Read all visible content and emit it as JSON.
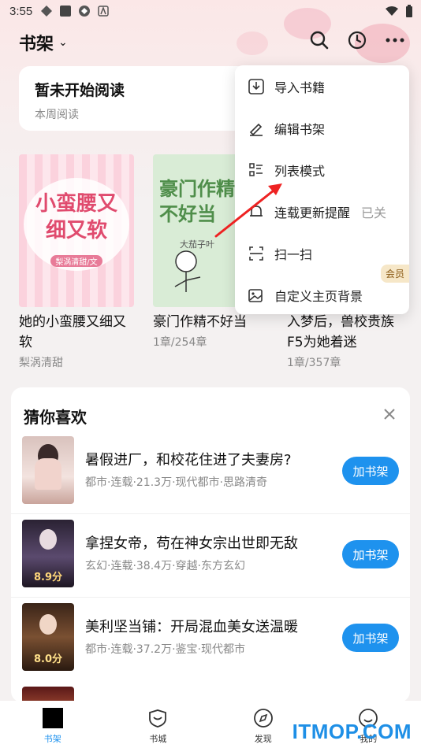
{
  "status_bar": {
    "time": "3:55"
  },
  "header": {
    "title": "书架",
    "caret": "⌄"
  },
  "reading": {
    "title": "暂未开始阅读",
    "subtitle": "本周阅读"
  },
  "shelf": [
    {
      "title_line1": "她的小蛮腰又细又",
      "title_line2": "软",
      "meta": "梨涡清甜",
      "cover_text": "小蛮腰又细又软",
      "cover_author": "梨涡清甜/文"
    },
    {
      "title_line1": "豪门作精不好当",
      "title_line2": "",
      "meta": "1章/254章",
      "cover_text": "豪门作精不好当",
      "cover_author": "大茄子叶"
    },
    {
      "title_line1": "入梦后，兽校贵族",
      "title_line2": "F5为她着迷",
      "meta": "1章/357章"
    }
  ],
  "menu": {
    "items": [
      {
        "label": "导入书籍",
        "icon": "import-icon"
      },
      {
        "label": "编辑书架",
        "icon": "edit-icon"
      },
      {
        "label": "列表模式",
        "icon": "list-icon"
      },
      {
        "label": "连载更新提醒",
        "icon": "bell-icon",
        "status": "已关"
      },
      {
        "label": "扫一扫",
        "icon": "scan-icon"
      },
      {
        "label": "自定义主页背景",
        "icon": "image-icon",
        "badge": "会员"
      }
    ]
  },
  "recommend": {
    "title": "猜你喜欢",
    "add_label": "加书架",
    "items": [
      {
        "name": "暑假进厂，和校花住进了夫妻房?",
        "meta": "都市·连载·21.3万·现代都市·思路清奇"
      },
      {
        "name": "拿捏女帝，苟在神女宗出世即无敌",
        "meta": "玄幻·连载·38.4万·穿越·东方玄幻",
        "cover_score": "8.9分"
      },
      {
        "name": "美利坚当铺：开局混血美女送温暖",
        "meta": "都市·连载·37.2万·鉴宝·现代都市",
        "cover_score": "8.0分"
      }
    ]
  },
  "nav": [
    {
      "label": "书架",
      "icon": "bookshelf-icon",
      "active": true
    },
    {
      "label": "书城",
      "icon": "bookstore-icon"
    },
    {
      "label": "发现",
      "icon": "compass-icon"
    },
    {
      "label": "我的",
      "icon": "profile-icon"
    }
  ],
  "watermark": "ITMOP.COM",
  "colors": {
    "accent": "#1e92ee",
    "cover1": "#f9c9d6",
    "cover2": "#d5ead3"
  }
}
